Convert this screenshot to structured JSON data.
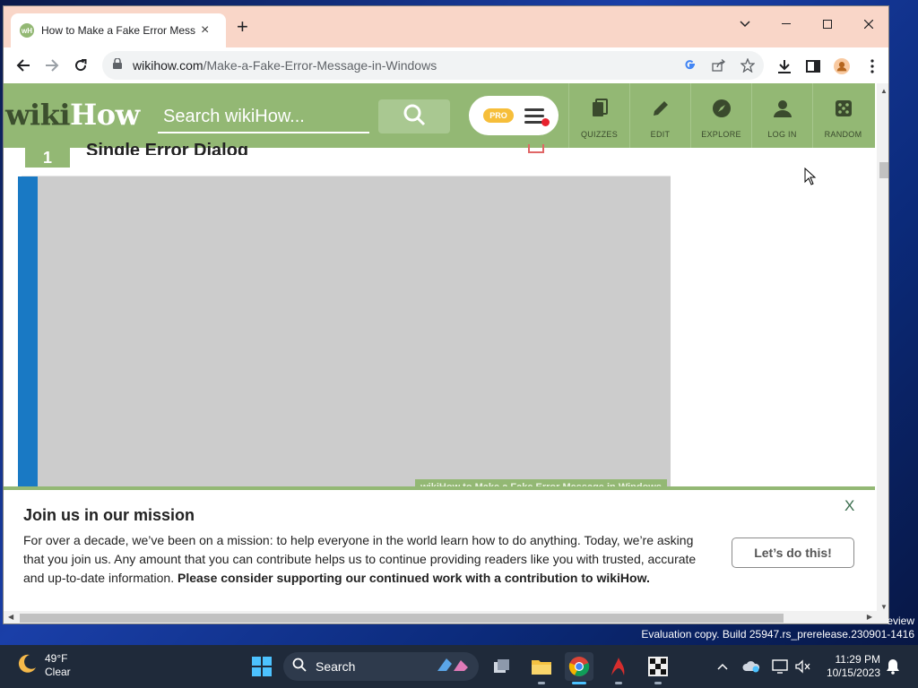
{
  "browser": {
    "tab_title": "How to Make a Fake Error Message in Windows",
    "tab_favicon_text": "wH",
    "new_tab_symbol": "+",
    "close_tab_symbol": "×",
    "url_domain": "wikihow.com",
    "url_path": "/Make-a-Fake-Error-Message-in-Windows"
  },
  "site": {
    "logo_wiki": "wiki",
    "logo_how": "How",
    "search_placeholder": "Search wikiHow...",
    "pro_label": "PRO",
    "nav": [
      {
        "label": "QUIZZES",
        "icon": "quizzes-icon"
      },
      {
        "label": "EDIT",
        "icon": "pencil-icon"
      },
      {
        "label": "EXPLORE",
        "icon": "compass-icon"
      },
      {
        "label": "LOG IN",
        "icon": "user-icon"
      },
      {
        "label": "RANDOM",
        "icon": "dice-icon"
      }
    ],
    "step_number": "1",
    "step_title": "Single Error Dialog",
    "image_caption": "wikiHow to Make a Fake Error Message in Windows"
  },
  "banner": {
    "title": "Join us in our mission",
    "body": "For over a decade, we’ve been on a mission: to help everyone in the world learn how to do anything. Today, we’re asking that you join us. Any amount that you can contribute helps us to continue providing readers like you with trusted, accurate and up-to-date information.",
    "body_bold": "Please consider supporting our continued work with a contribution to wikiHow.",
    "cta": "Let’s do this!",
    "close": "X"
  },
  "desktop": {
    "review_text": "eview",
    "eval_text": "Evaluation copy. Build 25947.rs_prerelease.230901-1416"
  },
  "taskbar": {
    "temperature": "49°F",
    "condition": "Clear",
    "search_label": "Search",
    "time": "11:29 PM",
    "date": "10/15/2023"
  },
  "colors": {
    "wikihow_green": "#93b874",
    "tab_strip": "#f9d6c8",
    "accent_blue": "#1979c4"
  }
}
